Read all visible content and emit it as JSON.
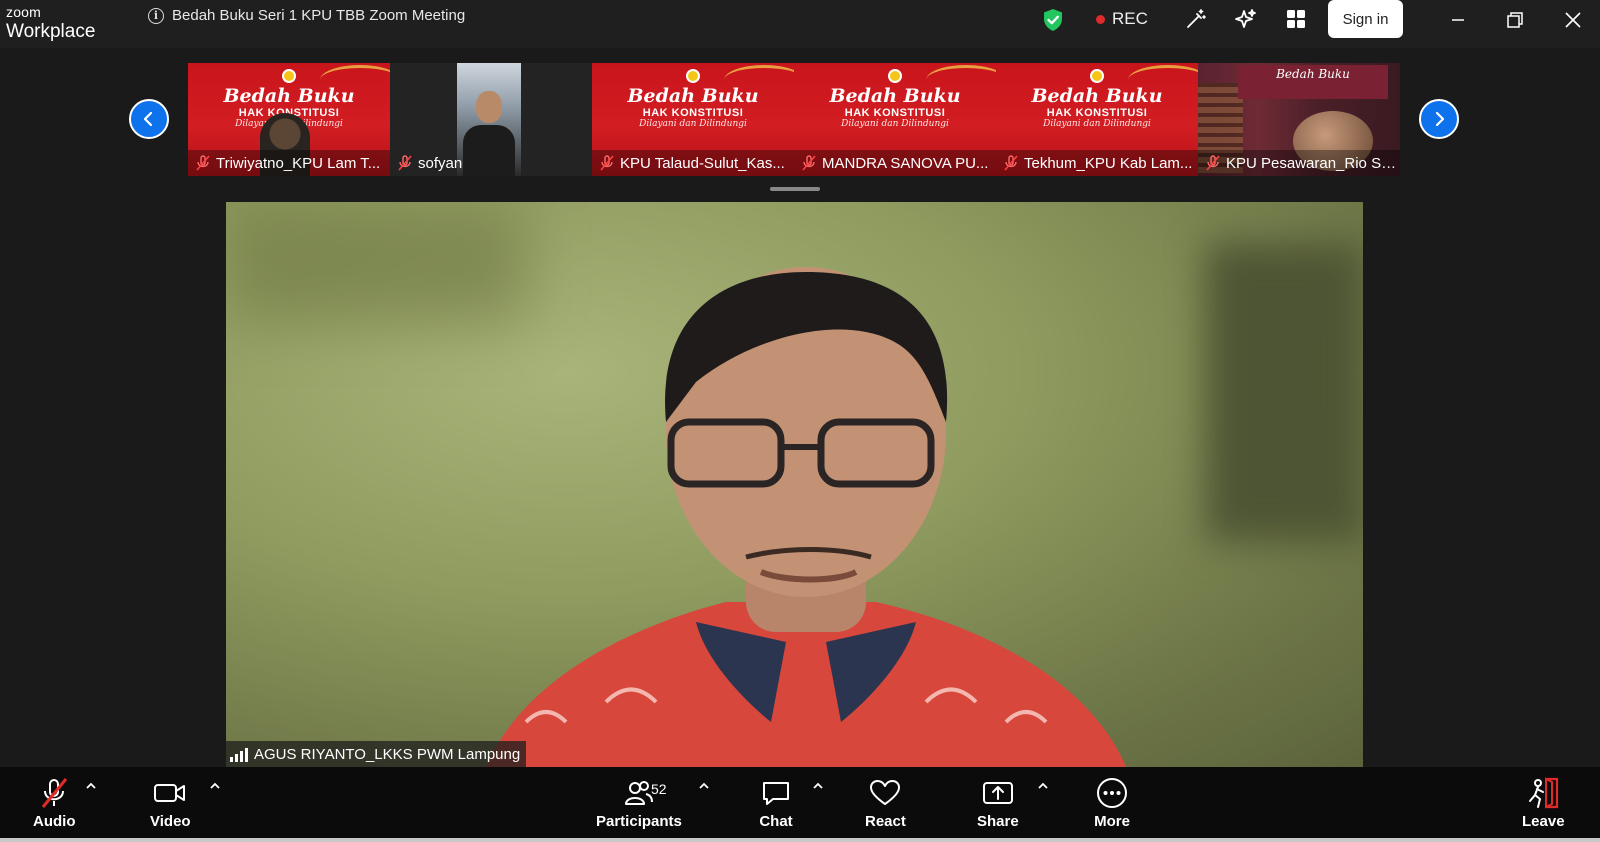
{
  "app": {
    "brand_top": "zoom",
    "brand_bottom": "Workplace"
  },
  "meeting": {
    "title": "Bedah Buku Seri 1 KPU TBB Zoom Meeting"
  },
  "titlebar": {
    "rec_label": "REC",
    "signin_label": "Sign in",
    "shield_color": "#22c55e",
    "rec_color": "#e02b2b"
  },
  "poster": {
    "title": "Bedah Buku",
    "subtitle": "HAK KONSTITUSI",
    "tagline": "Dilayani dan Dilindungi"
  },
  "thumbnails": [
    {
      "name": "Triwiyatno_KPU Lam T...",
      "kind": "poster-with-person",
      "muted": true
    },
    {
      "name": "sofyan",
      "kind": "camera",
      "muted": true
    },
    {
      "name": "KPU Talaud-Sulut_Kas...",
      "kind": "poster",
      "muted": true
    },
    {
      "name": "MANDRA SANOVA PU...",
      "kind": "poster",
      "muted": true
    },
    {
      "name": "Tekhum_KPU Kab Lam...",
      "kind": "poster",
      "muted": true
    },
    {
      "name": "KPU Pesawaran_Rio Sh...",
      "kind": "books",
      "muted": true
    }
  ],
  "books_banner": "Bedah Buku",
  "speaker": {
    "name": "AGUS RIYANTO_LKKS PWM Lampung"
  },
  "toolbar": {
    "audio": "Audio",
    "video": "Video",
    "participants": "Participants",
    "participants_count": "52",
    "chat": "Chat",
    "react": "React",
    "share": "Share",
    "more": "More",
    "leave": "Leave",
    "leave_color": "#e02b2b"
  }
}
